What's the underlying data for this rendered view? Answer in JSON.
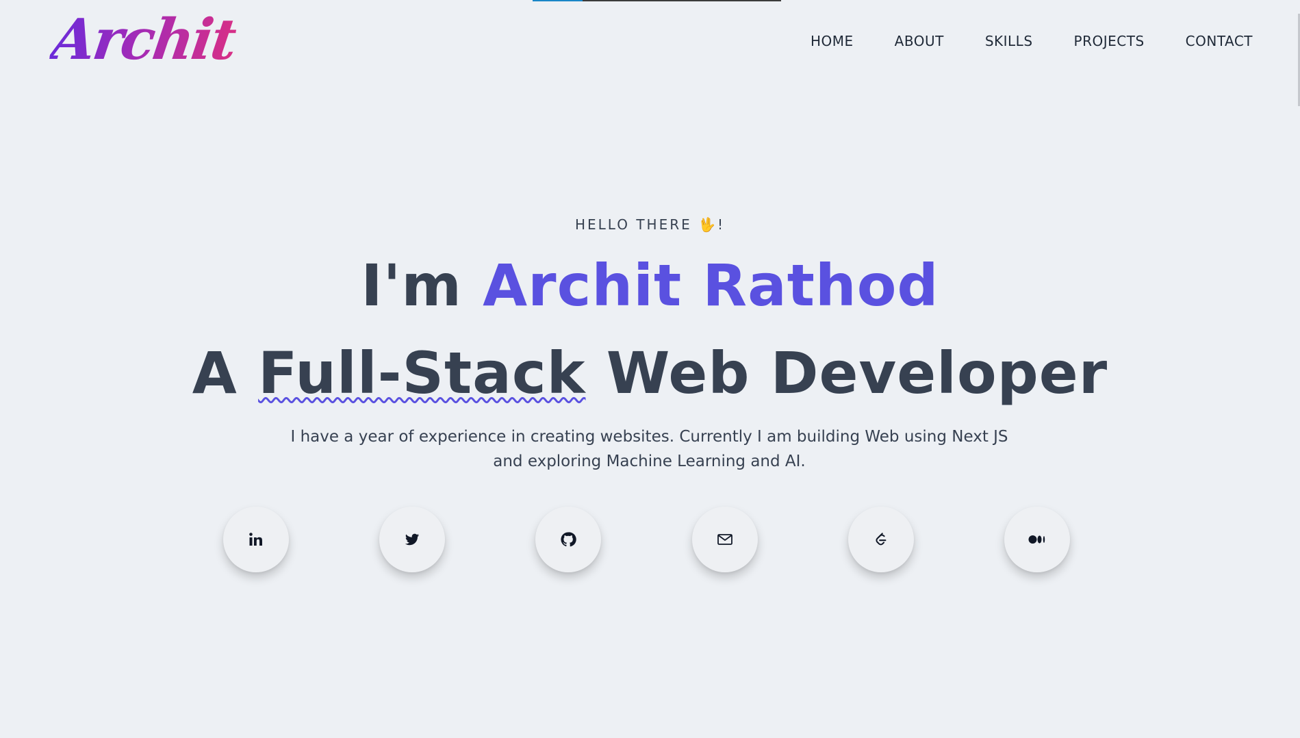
{
  "brand": {
    "logo_text": "Archit",
    "gradient_start": "#6b2bd9",
    "gradient_end": "#d72f86"
  },
  "nav": {
    "items": [
      {
        "label": "HOME"
      },
      {
        "label": "ABOUT"
      },
      {
        "label": "SKILLS"
      },
      {
        "label": "PROJECTS"
      },
      {
        "label": "CONTACT"
      }
    ]
  },
  "scroll_progress": {
    "fraction": 0.2,
    "fill_color": "#1a86c7"
  },
  "hero": {
    "greeting": "HELLO THERE 🖖!",
    "intro_prefix": "I'm ",
    "name": "Archit Rathod",
    "role_prefix": "A ",
    "role_highlight": "Full-Stack",
    "role_suffix": " Web Developer",
    "bio": "I have a year of experience in creating websites. Currently I am building Web using Next JS and exploring Machine Learning and AI.",
    "accent_color": "#5a51e0",
    "text_color": "#374151"
  },
  "socials": [
    {
      "icon": "linkedin-icon"
    },
    {
      "icon": "twitter-icon"
    },
    {
      "icon": "github-icon"
    },
    {
      "icon": "mail-icon"
    },
    {
      "icon": "leetcode-icon"
    },
    {
      "icon": "medium-icon"
    }
  ]
}
